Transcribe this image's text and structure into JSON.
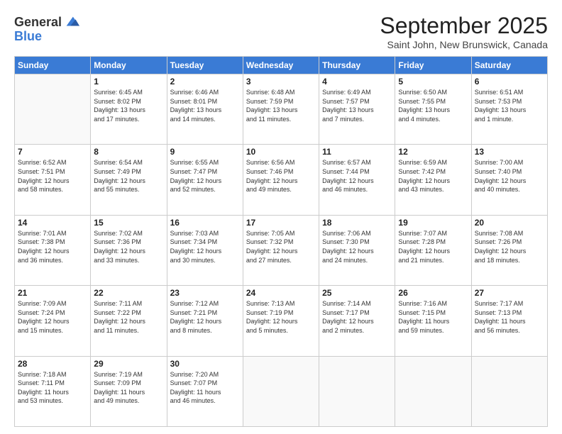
{
  "logo": {
    "general": "General",
    "blue": "Blue"
  },
  "header": {
    "month": "September 2025",
    "location": "Saint John, New Brunswick, Canada"
  },
  "weekdays": [
    "Sunday",
    "Monday",
    "Tuesday",
    "Wednesday",
    "Thursday",
    "Friday",
    "Saturday"
  ],
  "weeks": [
    [
      {
        "day": "",
        "info": ""
      },
      {
        "day": "1",
        "info": "Sunrise: 6:45 AM\nSunset: 8:02 PM\nDaylight: 13 hours\nand 17 minutes."
      },
      {
        "day": "2",
        "info": "Sunrise: 6:46 AM\nSunset: 8:01 PM\nDaylight: 13 hours\nand 14 minutes."
      },
      {
        "day": "3",
        "info": "Sunrise: 6:48 AM\nSunset: 7:59 PM\nDaylight: 13 hours\nand 11 minutes."
      },
      {
        "day": "4",
        "info": "Sunrise: 6:49 AM\nSunset: 7:57 PM\nDaylight: 13 hours\nand 7 minutes."
      },
      {
        "day": "5",
        "info": "Sunrise: 6:50 AM\nSunset: 7:55 PM\nDaylight: 13 hours\nand 4 minutes."
      },
      {
        "day": "6",
        "info": "Sunrise: 6:51 AM\nSunset: 7:53 PM\nDaylight: 13 hours\nand 1 minute."
      }
    ],
    [
      {
        "day": "7",
        "info": "Sunrise: 6:52 AM\nSunset: 7:51 PM\nDaylight: 12 hours\nand 58 minutes."
      },
      {
        "day": "8",
        "info": "Sunrise: 6:54 AM\nSunset: 7:49 PM\nDaylight: 12 hours\nand 55 minutes."
      },
      {
        "day": "9",
        "info": "Sunrise: 6:55 AM\nSunset: 7:47 PM\nDaylight: 12 hours\nand 52 minutes."
      },
      {
        "day": "10",
        "info": "Sunrise: 6:56 AM\nSunset: 7:46 PM\nDaylight: 12 hours\nand 49 minutes."
      },
      {
        "day": "11",
        "info": "Sunrise: 6:57 AM\nSunset: 7:44 PM\nDaylight: 12 hours\nand 46 minutes."
      },
      {
        "day": "12",
        "info": "Sunrise: 6:59 AM\nSunset: 7:42 PM\nDaylight: 12 hours\nand 43 minutes."
      },
      {
        "day": "13",
        "info": "Sunrise: 7:00 AM\nSunset: 7:40 PM\nDaylight: 12 hours\nand 40 minutes."
      }
    ],
    [
      {
        "day": "14",
        "info": "Sunrise: 7:01 AM\nSunset: 7:38 PM\nDaylight: 12 hours\nand 36 minutes."
      },
      {
        "day": "15",
        "info": "Sunrise: 7:02 AM\nSunset: 7:36 PM\nDaylight: 12 hours\nand 33 minutes."
      },
      {
        "day": "16",
        "info": "Sunrise: 7:03 AM\nSunset: 7:34 PM\nDaylight: 12 hours\nand 30 minutes."
      },
      {
        "day": "17",
        "info": "Sunrise: 7:05 AM\nSunset: 7:32 PM\nDaylight: 12 hours\nand 27 minutes."
      },
      {
        "day": "18",
        "info": "Sunrise: 7:06 AM\nSunset: 7:30 PM\nDaylight: 12 hours\nand 24 minutes."
      },
      {
        "day": "19",
        "info": "Sunrise: 7:07 AM\nSunset: 7:28 PM\nDaylight: 12 hours\nand 21 minutes."
      },
      {
        "day": "20",
        "info": "Sunrise: 7:08 AM\nSunset: 7:26 PM\nDaylight: 12 hours\nand 18 minutes."
      }
    ],
    [
      {
        "day": "21",
        "info": "Sunrise: 7:09 AM\nSunset: 7:24 PM\nDaylight: 12 hours\nand 15 minutes."
      },
      {
        "day": "22",
        "info": "Sunrise: 7:11 AM\nSunset: 7:22 PM\nDaylight: 12 hours\nand 11 minutes."
      },
      {
        "day": "23",
        "info": "Sunrise: 7:12 AM\nSunset: 7:21 PM\nDaylight: 12 hours\nand 8 minutes."
      },
      {
        "day": "24",
        "info": "Sunrise: 7:13 AM\nSunset: 7:19 PM\nDaylight: 12 hours\nand 5 minutes."
      },
      {
        "day": "25",
        "info": "Sunrise: 7:14 AM\nSunset: 7:17 PM\nDaylight: 12 hours\nand 2 minutes."
      },
      {
        "day": "26",
        "info": "Sunrise: 7:16 AM\nSunset: 7:15 PM\nDaylight: 11 hours\nand 59 minutes."
      },
      {
        "day": "27",
        "info": "Sunrise: 7:17 AM\nSunset: 7:13 PM\nDaylight: 11 hours\nand 56 minutes."
      }
    ],
    [
      {
        "day": "28",
        "info": "Sunrise: 7:18 AM\nSunset: 7:11 PM\nDaylight: 11 hours\nand 53 minutes."
      },
      {
        "day": "29",
        "info": "Sunrise: 7:19 AM\nSunset: 7:09 PM\nDaylight: 11 hours\nand 49 minutes."
      },
      {
        "day": "30",
        "info": "Sunrise: 7:20 AM\nSunset: 7:07 PM\nDaylight: 11 hours\nand 46 minutes."
      },
      {
        "day": "",
        "info": ""
      },
      {
        "day": "",
        "info": ""
      },
      {
        "day": "",
        "info": ""
      },
      {
        "day": "",
        "info": ""
      }
    ]
  ]
}
